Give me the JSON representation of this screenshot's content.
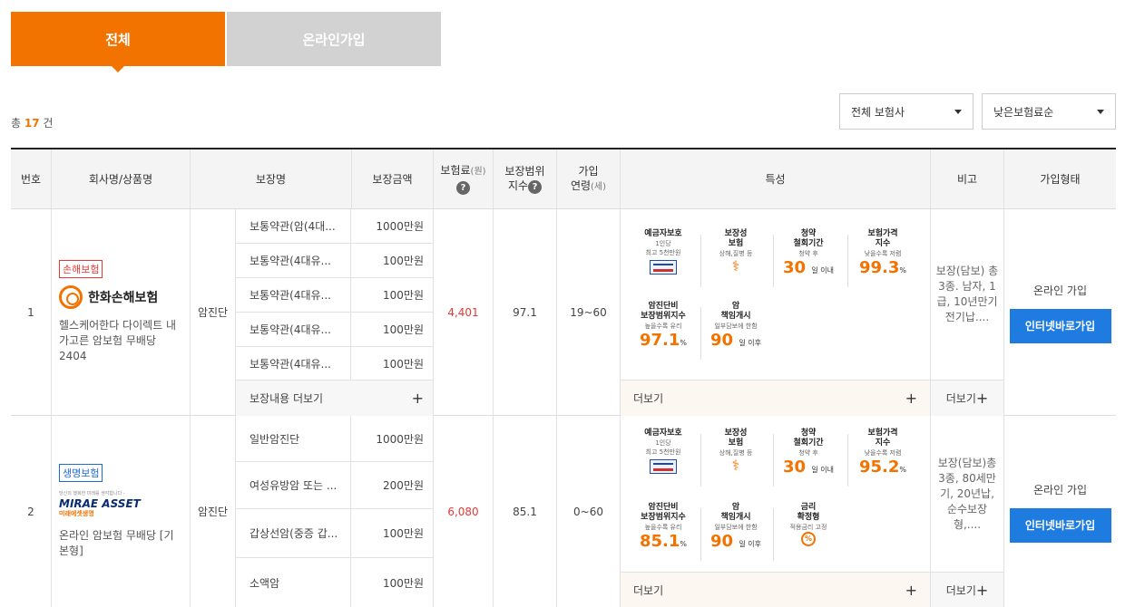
{
  "tabs": [
    {
      "label": "전체",
      "active": true
    },
    {
      "label": "온라인가입",
      "active": false
    }
  ],
  "count": {
    "prefix": "총",
    "value": "17",
    "suffix": "건"
  },
  "filters": {
    "insurer": "전체 보험사",
    "sort": "낮은보험료순"
  },
  "table": {
    "headers": {
      "no": "번호",
      "company": "회사명/상품명",
      "coverage_name": "보장명",
      "coverage_amount": "보장금액",
      "premium": "보험료",
      "premium_unit": "(원)",
      "range_1": "보장범위",
      "range_2": "지수",
      "age_1": "가입",
      "age_2": "연령",
      "age_unit": "(세)",
      "features": "특성",
      "note": "비고",
      "join_type": "가입형태"
    },
    "rows": [
      {
        "no": "1",
        "badge": "손해보험",
        "company_logo": "한화손해보험",
        "product": "헬스케어한다 다이렉트 내가고른 암보험 무배당 2404",
        "coverage_type": "암진단",
        "coverages": [
          {
            "name": "보통약관(암(4대...",
            "amount": "1000만원"
          },
          {
            "name": "보통약관(4대유...",
            "amount": "100만원"
          },
          {
            "name": "보통약관(4대유...",
            "amount": "100만원"
          },
          {
            "name": "보통약관(4대유...",
            "amount": "100만원"
          },
          {
            "name": "보통약관(4대유...",
            "amount": "100만원"
          }
        ],
        "more_coverage": "보장내용 더보기",
        "premium": "4,401",
        "range_index": "97.1",
        "age": "19~60",
        "features": {
          "deposit": {
            "title": "예금자보호",
            "sub1": "1인당",
            "sub2": "최고 5천만원"
          },
          "coverage": {
            "title1": "보장성",
            "title2": "보험",
            "sub": "상해,질병 등"
          },
          "withdraw": {
            "title1": "청약",
            "title2": "철회기간",
            "sub": "청약 후",
            "value": "30",
            "unit": "일 이내"
          },
          "price_index": {
            "title1": "보험가격",
            "title2": "지수",
            "sub": "낮을수록 저렴",
            "value": "99.3",
            "unit": "%"
          },
          "cancer_index": {
            "title1": "암진단비",
            "title2": "보장범위지수",
            "sub": "높을수록 유리",
            "value": "97.1",
            "unit": "%"
          },
          "start": {
            "title1": "암",
            "title2": "책임개시",
            "sub": "일부담보에 한함",
            "value": "90",
            "unit": "일 이후"
          }
        },
        "more": "더보기",
        "note": "보장(담보) 총 3종. 남자, 1급, 10년만기 전기납....",
        "note_more": "더보기",
        "join_label": "온라인 가입",
        "join_button": "인터넷바로가입"
      },
      {
        "no": "2",
        "badge": "생명보험",
        "company_logo_top": "당신의 행복한 미래를 생각합니다 -",
        "company_logo": "MIRAE ASSET",
        "company_logo_sub": "미래에셋생명",
        "product": "온라인 암보험 무배당 [기본형]",
        "coverage_type": "암진단",
        "coverages": [
          {
            "name": "일반암진단",
            "amount": "1000만원"
          },
          {
            "name": "여성유방암 또는 ...",
            "amount": "200만원"
          },
          {
            "name": "갑상선암(중증 갑...",
            "amount": "100만원"
          },
          {
            "name": "소액암",
            "amount": "100만원"
          }
        ],
        "premium": "6,080",
        "range_index": "85.1",
        "age": "0~60",
        "features": {
          "deposit": {
            "title": "예금자보호",
            "sub1": "1인당",
            "sub2": "최고 5천만원"
          },
          "coverage": {
            "title1": "보장성",
            "title2": "보험",
            "sub": "상해,질병 등"
          },
          "withdraw": {
            "title1": "청약",
            "title2": "철회기간",
            "sub": "청약 후",
            "value": "30",
            "unit": "일 이내"
          },
          "price_index": {
            "title1": "보험가격",
            "title2": "지수",
            "sub": "낮을수록 저렴",
            "value": "95.2",
            "unit": "%"
          },
          "cancer_index": {
            "title1": "암진단비",
            "title2": "보장범위지수",
            "sub": "높을수록 유리",
            "value": "85.1",
            "unit": "%"
          },
          "start": {
            "title1": "암",
            "title2": "책임개시",
            "sub": "일부담보에 한함",
            "value": "90",
            "unit": "일 이후"
          },
          "rate": {
            "title1": "금리",
            "title2": "확정형",
            "sub": "적용금리 고정",
            "icon": "%"
          }
        },
        "more": "더보기",
        "note": "보장(담보)총3종, 80세만기, 20년납, 순수보장형,....",
        "note_more": "더보기",
        "join_label": "온라인 가입",
        "join_button": "인터넷바로가입"
      }
    ]
  },
  "icons": {
    "caret": "caret-down-icon",
    "question": "question-icon",
    "plus": "plus-icon"
  },
  "colors": {
    "accent": "#f27300",
    "button": "#1e7be0",
    "premium": "#e53935"
  }
}
